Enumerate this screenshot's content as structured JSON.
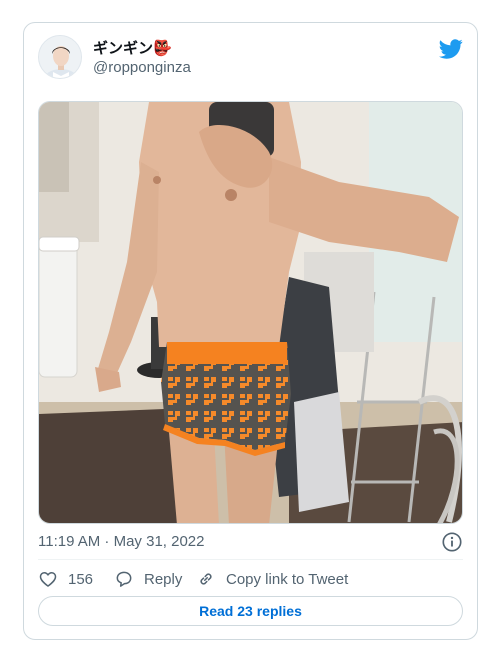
{
  "tweet": {
    "display_name": "ギンギン👺",
    "handle": "@ropponginza",
    "timestamp": "11:19 AM · May 31, 2022"
  },
  "actions": {
    "likes": "156",
    "reply_label": "Reply",
    "copy_label": "Copy link to Tweet"
  },
  "replies_button": "Read 23 replies",
  "icons": {
    "brand": "twitter-bird-icon",
    "info": "info-icon",
    "like": "heart-icon",
    "reply": "speech-bubble-icon",
    "copy": "link-icon"
  },
  "colors": {
    "brand": "#1d9bf0",
    "link": "#006fd6",
    "muted": "#536471",
    "border": "#cfd9de",
    "underwear_gray": "#555552",
    "underwear_orange": "#f58220"
  }
}
